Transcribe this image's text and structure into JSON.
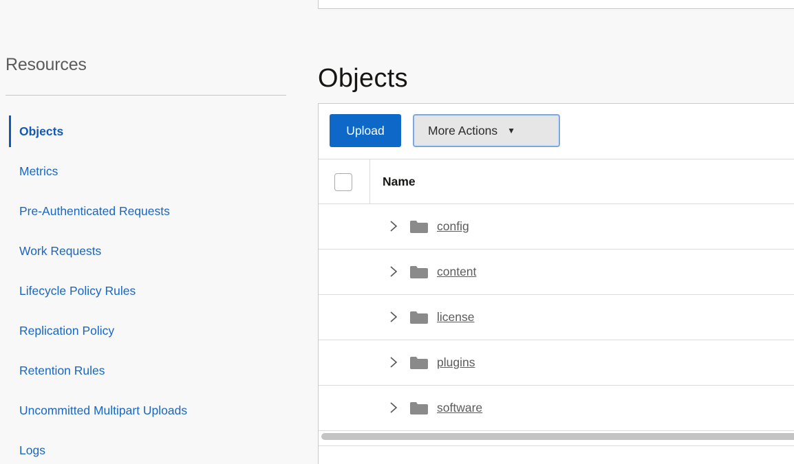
{
  "sidebar": {
    "title": "Resources",
    "items": [
      {
        "label": "Objects",
        "active": true
      },
      {
        "label": "Metrics"
      },
      {
        "label": "Pre-Authenticated Requests"
      },
      {
        "label": "Work Requests"
      },
      {
        "label": "Lifecycle Policy Rules"
      },
      {
        "label": "Replication Policy"
      },
      {
        "label": "Retention Rules"
      },
      {
        "label": "Uncommitted Multipart Uploads"
      },
      {
        "label": "Logs"
      }
    ]
  },
  "main": {
    "title": "Objects",
    "toolbar": {
      "upload_label": "Upload",
      "more_actions_label": "More Actions"
    },
    "table": {
      "columns": [
        "Name"
      ],
      "rows": [
        {
          "name": "config",
          "type": "folder"
        },
        {
          "name": "content",
          "type": "folder"
        },
        {
          "name": "license",
          "type": "folder"
        },
        {
          "name": "plugins",
          "type": "folder"
        },
        {
          "name": "software",
          "type": "folder"
        }
      ]
    }
  },
  "colors": {
    "accent": "#0d68c7",
    "link": "#1a66c2",
    "folder": "#8a8a8a"
  },
  "icons": {
    "expand": "chevron-right-icon",
    "folder": "folder-icon",
    "dropdown": "caret-down-icon"
  }
}
